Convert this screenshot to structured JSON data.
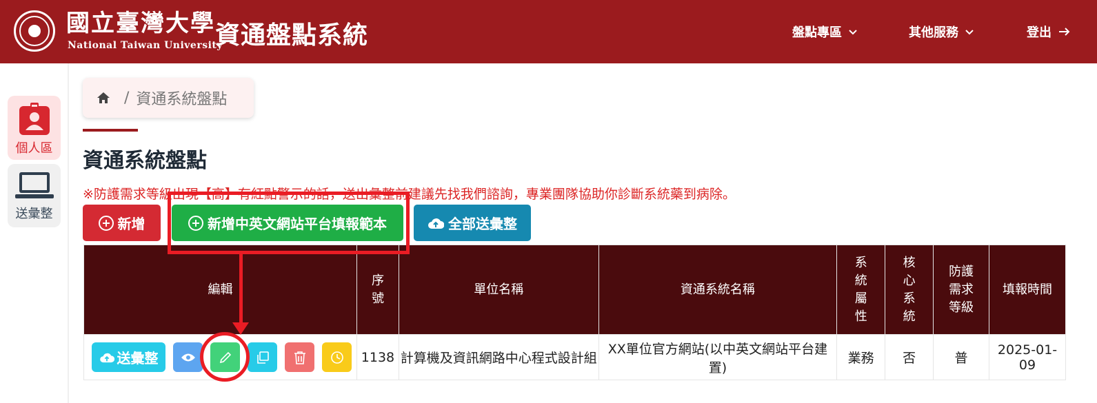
{
  "header": {
    "university_cn": "國立臺灣大學",
    "university_en": "National Taiwan University",
    "system_title": "資通盤點系統",
    "nav": [
      {
        "label": "盤點專區"
      },
      {
        "label": "其他服務"
      },
      {
        "label": "登出"
      }
    ]
  },
  "sidebar": {
    "items": [
      {
        "label": "個人區",
        "icon": "user-badge-icon"
      },
      {
        "label": "送彙整",
        "icon": "laptop-icon"
      }
    ]
  },
  "breadcrumb": {
    "current": "資通系統盤點"
  },
  "page": {
    "title": "資通系統盤點",
    "notice": "※防護需求等級出現【高】有紅點警示的話，送出彙整前建議先找我們諮詢，專業團隊協助你診斷系統藥到病除。"
  },
  "buttons": {
    "add": "新增",
    "add_template": "新增中英文網站平台填報範本",
    "submit_all": "全部送彙整"
  },
  "table": {
    "headers": [
      "編輯",
      "序號",
      "單位名稱",
      "資通系統名稱",
      "系統屬性",
      "核心系統",
      "防護需求等級",
      "填報時間"
    ],
    "rows": [
      {
        "send_label": "送彙整",
        "serial": "1138",
        "unit": "計算機及資訊網路中心程式設計組",
        "system": "XX單位官方網站(以中英文網站平台建置)",
        "attribute": "業務",
        "core": "否",
        "level": "普",
        "date": "2025-01-09"
      }
    ]
  },
  "colors": {
    "brand": "#9b1b1e",
    "table_header": "#4a0b0d",
    "add": "#d42a33",
    "template": "#1fae46",
    "submit_all": "#1689b0",
    "annotation": "#ea1c24"
  }
}
